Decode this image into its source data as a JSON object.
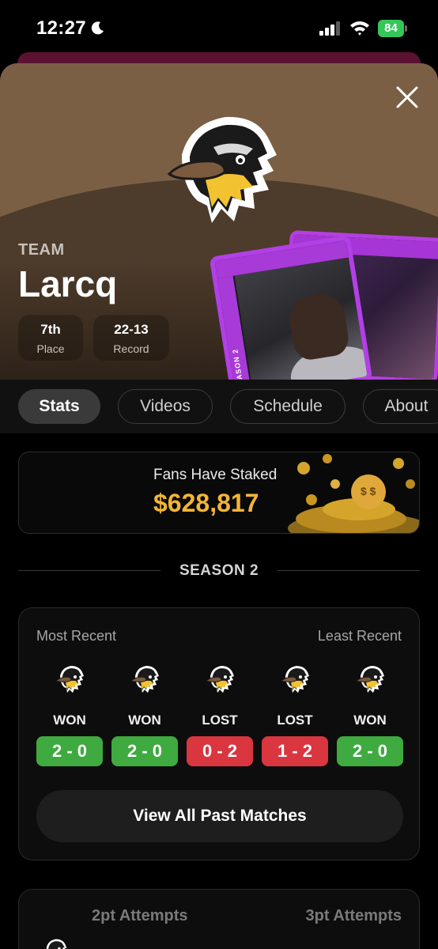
{
  "status_bar": {
    "time": "12:27",
    "battery": "84"
  },
  "hero": {
    "team_label": "TEAM",
    "team_name": "Larcq",
    "stats": [
      {
        "value": "7th",
        "label": "Place"
      },
      {
        "value": "22-13",
        "label": "Record"
      }
    ],
    "card_side_label": "SEASON 2",
    "colors": {
      "hero_bg": "#7a5f45",
      "card_border": "#b240e6"
    }
  },
  "tabs": [
    {
      "label": "Stats",
      "active": true
    },
    {
      "label": "Videos",
      "active": false
    },
    {
      "label": "Schedule",
      "active": false
    },
    {
      "label": "About",
      "active": false
    }
  ],
  "staked": {
    "label": "Fans Have Staked",
    "amount": "$628,817",
    "amount_color": "#f2b535"
  },
  "season": {
    "label": "SEASON 2"
  },
  "recent": {
    "left_label": "Most Recent",
    "right_label": "Least Recent",
    "matches": [
      {
        "result": "WON",
        "score": "2 - 0"
      },
      {
        "result": "WON",
        "score": "2 - 0"
      },
      {
        "result": "LOST",
        "score": "0 - 2"
      },
      {
        "result": "LOST",
        "score": "1 - 2"
      },
      {
        "result": "WON",
        "score": "2 - 0"
      }
    ],
    "view_all_label": "View All Past Matches",
    "colors": {
      "won": "#3faa3f",
      "lost": "#d9363f"
    }
  },
  "attempts": {
    "two_pt_label": "2pt Attempts",
    "three_pt_label": "3pt Attempts"
  }
}
